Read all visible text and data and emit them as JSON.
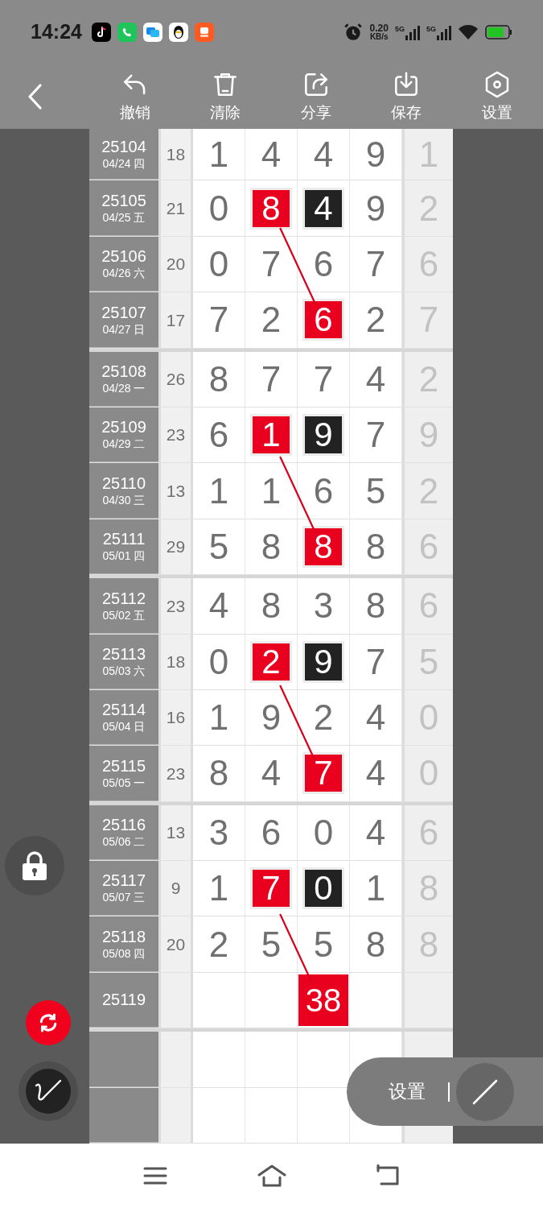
{
  "status_bar": {
    "time": "14:24",
    "net_speed_value": "0.20",
    "net_speed_unit": "KB/s",
    "networks": [
      "5G",
      "5G"
    ]
  },
  "toolbar": {
    "items": [
      {
        "kind": "undo",
        "label": "撤销"
      },
      {
        "kind": "clear",
        "label": "清除"
      },
      {
        "kind": "share",
        "label": "分享"
      },
      {
        "kind": "save",
        "label": "保存"
      },
      {
        "kind": "settings",
        "label": "设置"
      }
    ]
  },
  "groups": [
    {
      "rows": [
        {
          "period": "25104",
          "date": "04/24 四",
          "sum": "18",
          "cells": [
            {
              "kind": "plain",
              "value": "1"
            },
            {
              "kind": "plain",
              "value": "4"
            },
            {
              "kind": "plain",
              "value": "4"
            },
            {
              "kind": "plain",
              "value": "9"
            }
          ],
          "tail": "1"
        },
        {
          "period": "25105",
          "date": "04/25 五",
          "sum": "21",
          "cells": [
            {
              "kind": "plain",
              "value": "0"
            },
            {
              "kind": "red",
              "value": "8"
            },
            {
              "kind": "black",
              "value": "4"
            },
            {
              "kind": "plain",
              "value": "9"
            }
          ],
          "tail": "2"
        },
        {
          "period": "25106",
          "date": "04/26 六",
          "sum": "20",
          "cells": [
            {
              "kind": "plain",
              "value": "0"
            },
            {
              "kind": "plain",
              "value": "7"
            },
            {
              "kind": "plain",
              "value": "6"
            },
            {
              "kind": "plain",
              "value": "7"
            }
          ],
          "tail": "6"
        },
        {
          "period": "25107",
          "date": "04/27 日",
          "sum": "17",
          "cells": [
            {
              "kind": "plain",
              "value": "7"
            },
            {
              "kind": "plain",
              "value": "2"
            },
            {
              "kind": "red",
              "value": "6"
            },
            {
              "kind": "plain",
              "value": "2"
            }
          ],
          "tail": "7"
        }
      ]
    },
    {
      "rows": [
        {
          "period": "25108",
          "date": "04/28 一",
          "sum": "26",
          "cells": [
            {
              "kind": "plain",
              "value": "8"
            },
            {
              "kind": "plain",
              "value": "7"
            },
            {
              "kind": "plain",
              "value": "7"
            },
            {
              "kind": "plain",
              "value": "4"
            }
          ],
          "tail": "2"
        },
        {
          "period": "25109",
          "date": "04/29 二",
          "sum": "23",
          "cells": [
            {
              "kind": "plain",
              "value": "6"
            },
            {
              "kind": "red",
              "value": "1"
            },
            {
              "kind": "black",
              "value": "9"
            },
            {
              "kind": "plain",
              "value": "7"
            }
          ],
          "tail": "9"
        },
        {
          "period": "25110",
          "date": "04/30 三",
          "sum": "13",
          "cells": [
            {
              "kind": "plain",
              "value": "1"
            },
            {
              "kind": "plain",
              "value": "1"
            },
            {
              "kind": "plain",
              "value": "6"
            },
            {
              "kind": "plain",
              "value": "5"
            }
          ],
          "tail": "2"
        },
        {
          "period": "25111",
          "date": "05/01 四",
          "sum": "29",
          "cells": [
            {
              "kind": "plain",
              "value": "5"
            },
            {
              "kind": "plain",
              "value": "8"
            },
            {
              "kind": "red",
              "value": "8"
            },
            {
              "kind": "plain",
              "value": "8"
            }
          ],
          "tail": "6"
        }
      ]
    },
    {
      "rows": [
        {
          "period": "25112",
          "date": "05/02 五",
          "sum": "23",
          "cells": [
            {
              "kind": "plain",
              "value": "4"
            },
            {
              "kind": "plain",
              "value": "8"
            },
            {
              "kind": "plain",
              "value": "3"
            },
            {
              "kind": "plain",
              "value": "8"
            }
          ],
          "tail": "6"
        },
        {
          "period": "25113",
          "date": "05/03 六",
          "sum": "18",
          "cells": [
            {
              "kind": "plain",
              "value": "0"
            },
            {
              "kind": "red",
              "value": "2"
            },
            {
              "kind": "black",
              "value": "9"
            },
            {
              "kind": "plain",
              "value": "7"
            }
          ],
          "tail": "5"
        },
        {
          "period": "25114",
          "date": "05/04 日",
          "sum": "16",
          "cells": [
            {
              "kind": "plain",
              "value": "1"
            },
            {
              "kind": "plain",
              "value": "9"
            },
            {
              "kind": "plain",
              "value": "2"
            },
            {
              "kind": "plain",
              "value": "4"
            }
          ],
          "tail": "0"
        },
        {
          "period": "25115",
          "date": "05/05 一",
          "sum": "23",
          "cells": [
            {
              "kind": "plain",
              "value": "8"
            },
            {
              "kind": "plain",
              "value": "4"
            },
            {
              "kind": "red",
              "value": "7"
            },
            {
              "kind": "plain",
              "value": "4"
            }
          ],
          "tail": "0"
        }
      ]
    },
    {
      "rows": [
        {
          "period": "25116",
          "date": "05/06 二",
          "sum": "13",
          "cells": [
            {
              "kind": "plain",
              "value": "3"
            },
            {
              "kind": "plain",
              "value": "6"
            },
            {
              "kind": "plain",
              "value": "0"
            },
            {
              "kind": "plain",
              "value": "4"
            }
          ],
          "tail": "6"
        },
        {
          "period": "25117",
          "date": "05/07 三",
          "sum": "9",
          "cells": [
            {
              "kind": "plain",
              "value": "1"
            },
            {
              "kind": "red",
              "value": "7"
            },
            {
              "kind": "black",
              "value": "0"
            },
            {
              "kind": "plain",
              "value": "1"
            }
          ],
          "tail": "8"
        },
        {
          "period": "25118",
          "date": "05/08 四",
          "sum": "20",
          "cells": [
            {
              "kind": "plain",
              "value": "2"
            },
            {
              "kind": "plain",
              "value": "5"
            },
            {
              "kind": "plain",
              "value": "5"
            },
            {
              "kind": "plain",
              "value": "8"
            }
          ],
          "tail": "8"
        },
        {
          "period": "25119",
          "cells": [
            {
              "kind": "blank"
            },
            {
              "kind": "blank"
            },
            {
              "kind": "forecast",
              "value": "38"
            },
            {
              "kind": "blank"
            }
          ]
        }
      ]
    }
  ],
  "float_panel": {
    "label": "设置"
  }
}
